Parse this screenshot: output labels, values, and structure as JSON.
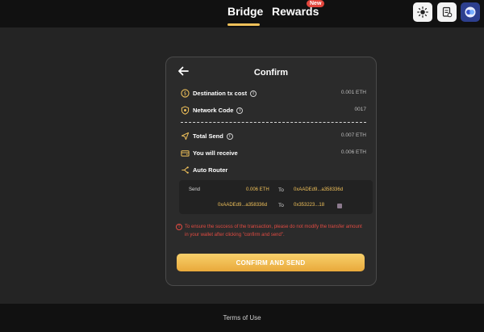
{
  "header": {
    "tabs": [
      {
        "label": "Bridge",
        "active": true
      },
      {
        "label": "Rewards",
        "badge": "New"
      }
    ],
    "icons": [
      "sun-icon",
      "document-icon",
      "wallet-icon"
    ],
    "accent_color": "#f0c15a",
    "badge_color": "#e2453c"
  },
  "card": {
    "title": "Confirm",
    "rows": [
      {
        "label": "Destination tx cost",
        "value": "0.001 ETH",
        "icon": "coin-icon",
        "info": true
      },
      {
        "label": "Network Code",
        "value": "0017",
        "icon": "shield-icon",
        "info": true
      },
      {
        "label": "Total Send",
        "value": "0.007 ETH",
        "icon": "send-icon",
        "info": true
      },
      {
        "label": "You will receive",
        "value": "0.006 ETH",
        "icon": "wallet-receive-icon",
        "info": false
      },
      {
        "label": "Auto Router",
        "value": "",
        "icon": "router-icon",
        "info": false
      }
    ],
    "route": {
      "send_label": "Send",
      "amount": "0.006 ETH",
      "to_label_1": "To",
      "to_address_1": "0xAADEd9...a358336d",
      "from_address_2": "0xAADEd9...a358336d",
      "to_label_2": "To",
      "to_address_2": "0x353223...18"
    },
    "warning": "To ensure the success of the transaction, please do not modify the transfer amount in your wallet after clicking \"confirm and send\".",
    "confirm_button": "CONFIRM AND SEND"
  },
  "footer": {
    "terms": "Terms of Use"
  }
}
